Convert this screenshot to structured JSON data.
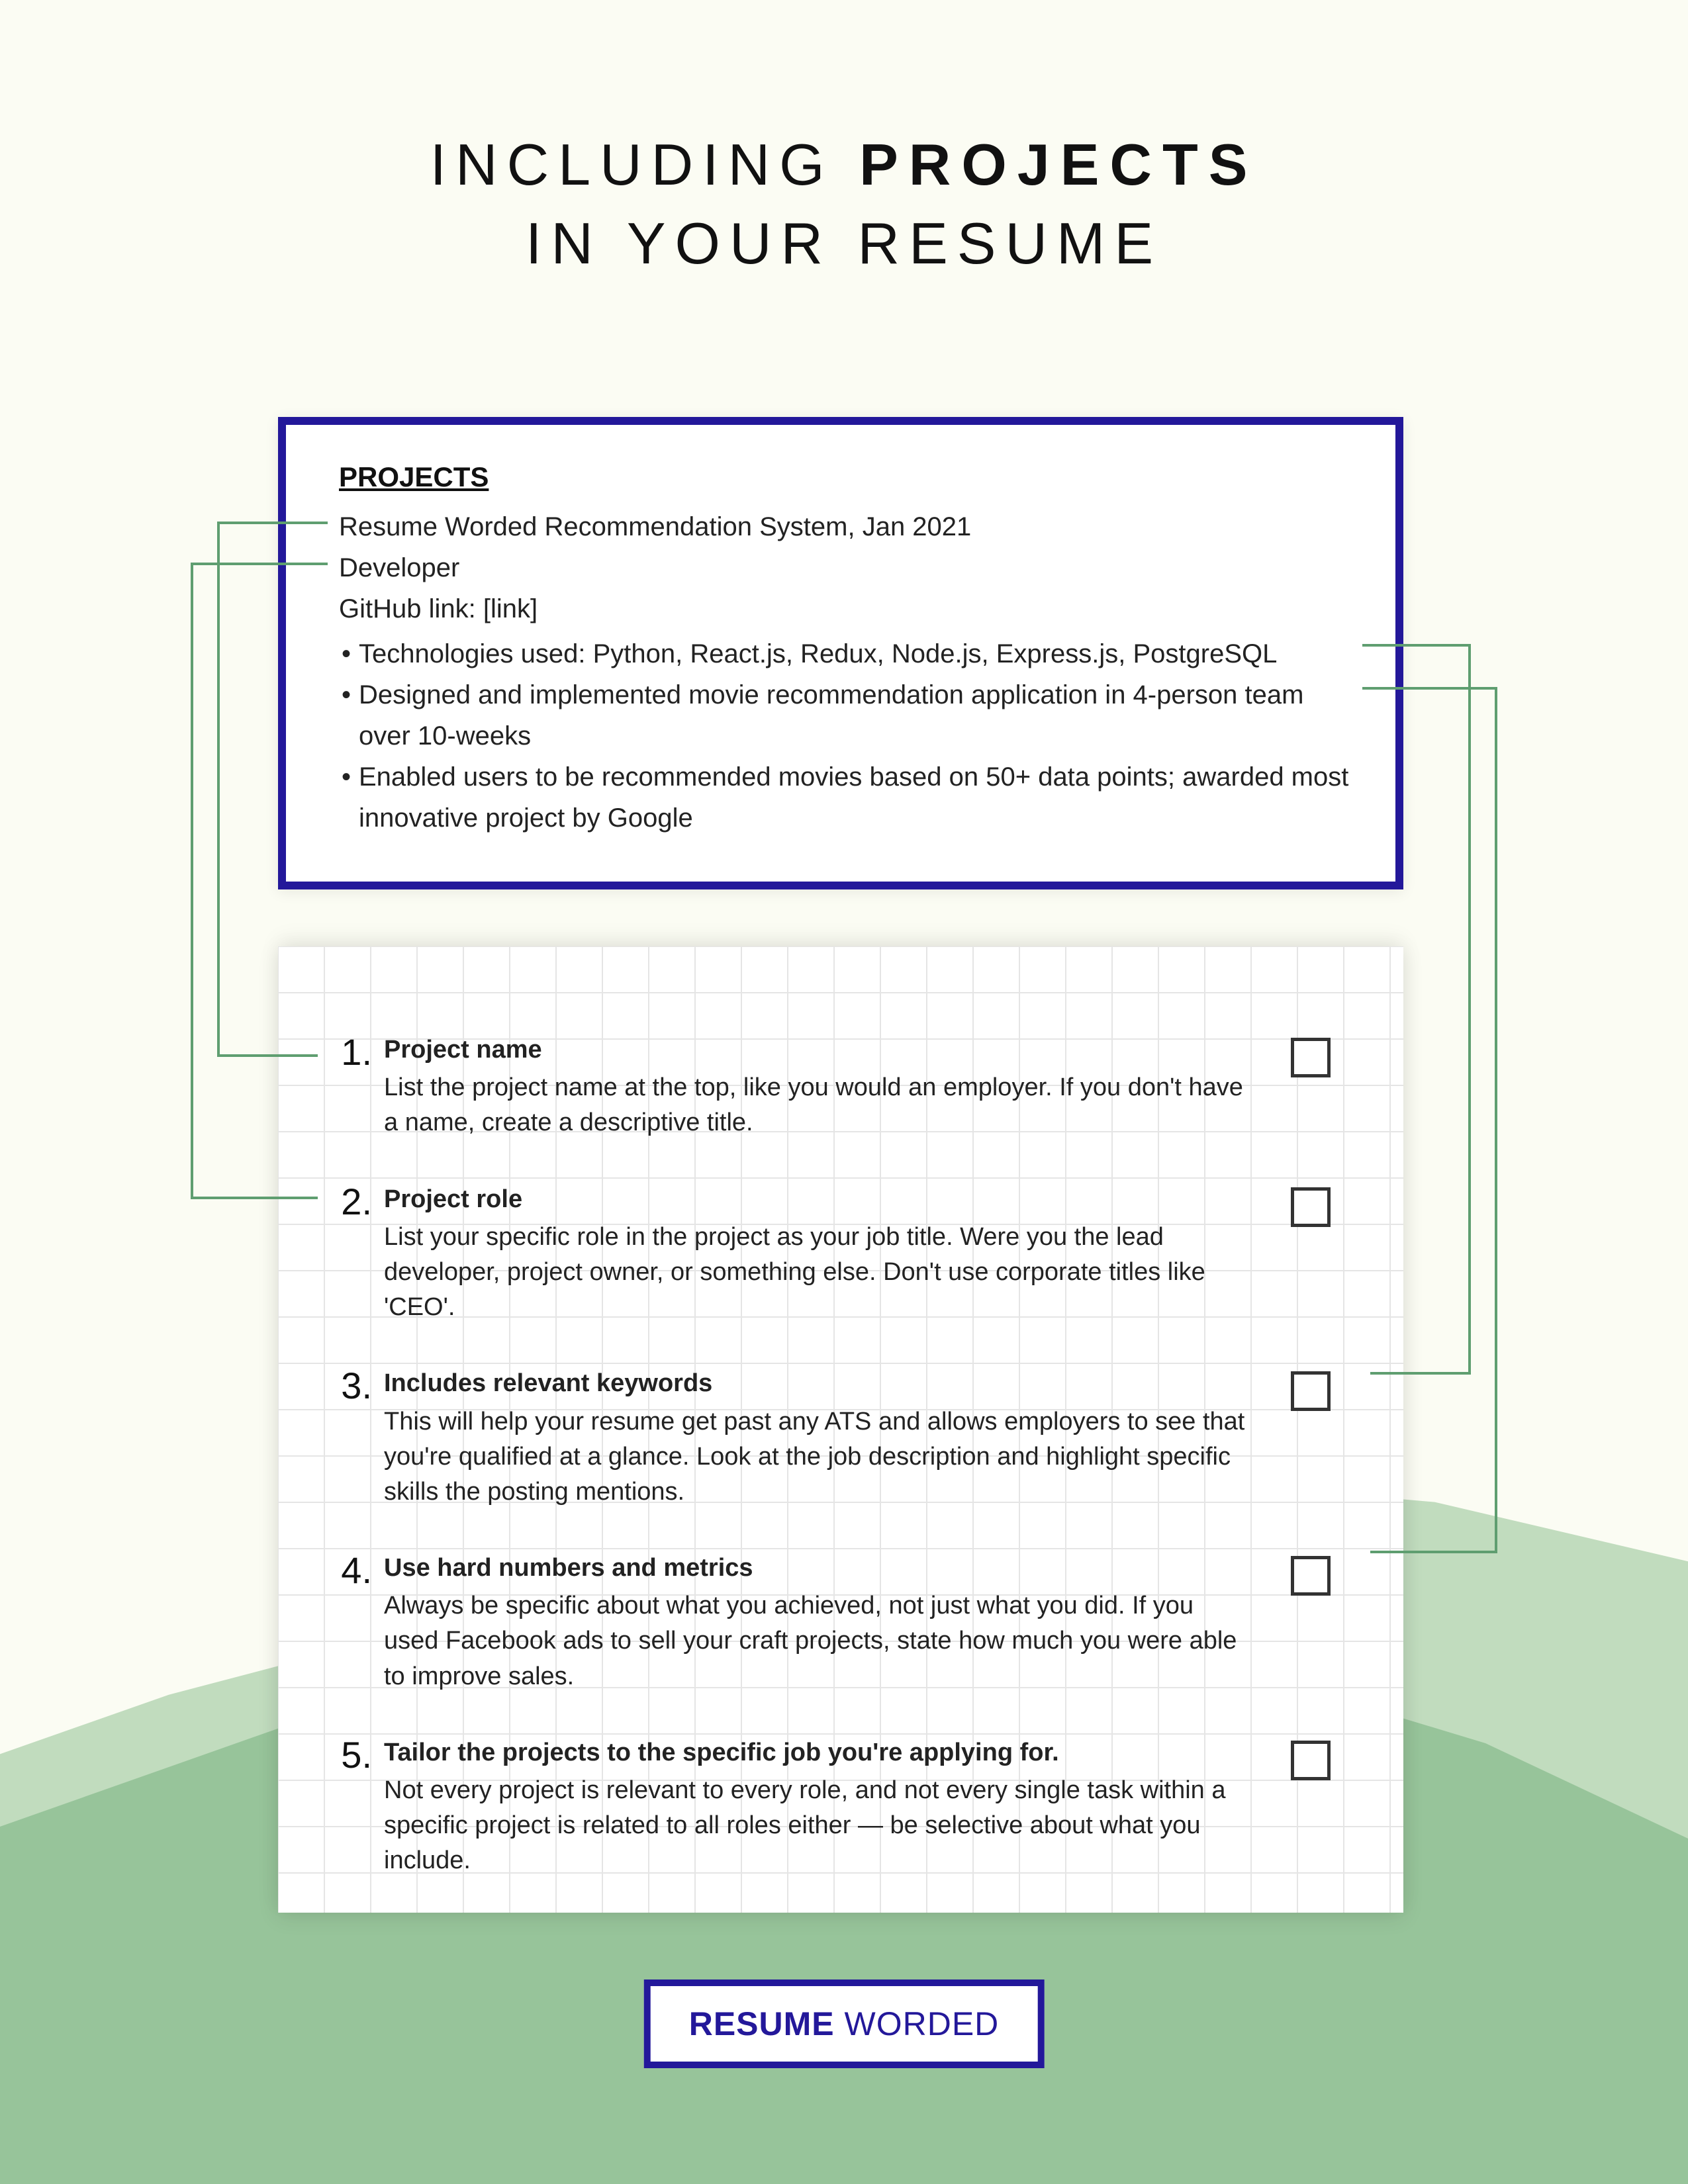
{
  "title": {
    "line1_pre": "INCLUDING ",
    "line1_bold": "PROJECTS",
    "line2": "IN YOUR RESUME"
  },
  "projects": {
    "heading": "PROJECTS",
    "line1": "Resume Worded Recommendation System, Jan 2021",
    "line2": "Developer",
    "line3": "GitHub link: [link]",
    "bullets": [
      "Technologies used: Python, React.js, Redux, Node.js, Express.js, PostgreSQL",
      "Designed and implemented movie recommendation application in 4-person team over 10-weeks",
      "Enabled users to be recommended movies based on 50+ data points; awarded most innovative project by Google"
    ]
  },
  "checklist": [
    {
      "num": "1.",
      "title": "Project name",
      "body": "List the project name at the top, like you would an employer. If you don't have a name, create a descriptive title."
    },
    {
      "num": "2.",
      "title": "Project role",
      "body": "List your specific role in the project as your job title. Were you the lead developer, project owner, or something else. Don't use corporate titles like 'CEO'."
    },
    {
      "num": "3.",
      "title": "Includes relevant keywords",
      "body": "This will help your resume get past any ATS and allows employers to see that you're qualified at a glance. Look at the job description and highlight specific skills the posting mentions."
    },
    {
      "num": "4.",
      "title": "Use hard numbers and metrics",
      "body": "Always be specific about what you achieved, not just what you did. If you used Facebook ads to sell your craft projects, state how much you were able to improve sales."
    },
    {
      "num": "5.",
      "title": "Tailor the projects to the specific job you're applying for.",
      "body": "Not every project is relevant to every role, and not every single task within a specific project is related to all roles either — be selective about what you include."
    }
  ],
  "logo": {
    "bold": "RESUME",
    "rest": " WORDED"
  }
}
